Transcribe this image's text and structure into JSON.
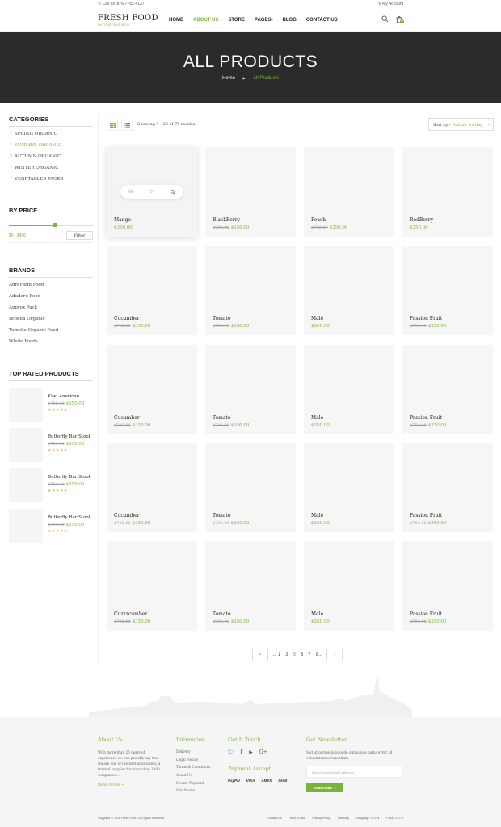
{
  "topbar": {
    "phone": "Call us: 876-7782-4137",
    "account": "My Account"
  },
  "logo": {
    "name": "FRESH FOOD",
    "tagline": "NATURE INSPIRED"
  },
  "nav": [
    "HOME",
    "ABOUT US",
    "STORE",
    "PAGES",
    "BLOG",
    "CONTACT US"
  ],
  "cart_count": "0",
  "banner": {
    "title": "ALL PRODUCTS",
    "crumb_home": "Home",
    "crumb_current": "All Products"
  },
  "sidebar": {
    "categories_title": "CATEGORIES",
    "categories": [
      "SPRING ORGANIC",
      "SUMMER ORGANIC",
      "AUTUMN ORGANIC",
      "WINTER ORGANIC",
      "VEGETABLES PACKS"
    ],
    "price_title": "BY PRICE",
    "price_range": "$0 - $400",
    "filter_label": "Filter",
    "price_slider_fraction": 0.5,
    "brands_title": "BRANDS",
    "brands": [
      "AdreFarm Food",
      "Adudero Food",
      "Approx Pack",
      "Brokita Organic",
      "Tomoko Organic Food",
      "Whole Foods"
    ],
    "top_rated_title": "TOP RATED PRODUCTS",
    "top_rated": [
      {
        "name": "Kiwi Anerican",
        "old": "$700.00",
        "price": "$350.00"
      },
      {
        "name": "Butterfly Bar Stool",
        "old": "$700.00",
        "price": "$350.00"
      },
      {
        "name": "Butterfly Bar Stool",
        "old": "$700.00",
        "price": "$350.00"
      },
      {
        "name": "Butterfly Bar Stool",
        "old": "$700.00",
        "price": "$350.00"
      }
    ]
  },
  "toolbar": {
    "showing": "Showing 1 - 20 of 75 results",
    "sort_label": "Sort by :",
    "sort_value": "Default sorting"
  },
  "products": [
    {
      "name": "Mango",
      "old": "",
      "price": "$350.00"
    },
    {
      "name": "BlackBerry",
      "old": "$700.00",
      "price": "$350.00"
    },
    {
      "name": "Peach",
      "old": "$700.00",
      "price": "$350.00"
    },
    {
      "name": "RedBerry",
      "old": "",
      "price": "$350.00"
    },
    {
      "name": "Cucumber",
      "old": "$700.00",
      "price": "$350.00"
    },
    {
      "name": "Tomato",
      "old": "$700.00",
      "price": "$350.00"
    },
    {
      "name": "Male",
      "old": "",
      "price": "$350.00"
    },
    {
      "name": "Passion Fruit",
      "old": "$700.00",
      "price": "$350.00"
    },
    {
      "name": "Cucumber",
      "old": "$700.00",
      "price": "$350.00"
    },
    {
      "name": "Tomato",
      "old": "$700.00",
      "price": "$350.00"
    },
    {
      "name": "Male",
      "old": "",
      "price": "$350.00"
    },
    {
      "name": "Passion Fruit",
      "old": "$700.00",
      "price": "$350.00"
    },
    {
      "name": "Cucumber",
      "old": "$700.00",
      "price": "$350.00"
    },
    {
      "name": "Tomato",
      "old": "$700.00",
      "price": "$350.00"
    },
    {
      "name": "Male",
      "old": "",
      "price": "$350.00"
    },
    {
      "name": "Passion Fruit",
      "old": "$700.00",
      "price": "$350.00"
    },
    {
      "name": "Cuzzzcumber",
      "old": "$700.00",
      "price": "$350.00"
    },
    {
      "name": "Tomato",
      "old": "$700.00",
      "price": "$350.00"
    },
    {
      "name": "Male",
      "old": "",
      "price": "$350.00"
    },
    {
      "name": "Passion Fruit",
      "old": "$700.00",
      "price": "$350.00"
    }
  ],
  "pagination": {
    "prev": "‹",
    "next": "›",
    "lead": "...",
    "pages": [
      "1",
      "3",
      "5",
      "6",
      "7",
      "8..."
    ],
    "active": "5"
  },
  "footer": {
    "about_title": "About Us",
    "about_text": "With more than 25 years of experience we can proudly say that we are one of the best in business, a trusted supplier for more than 1000 companies...",
    "readmore": "READ MORE",
    "info_title": "Infomation",
    "info_links": [
      "Delivery",
      "Legal Notice",
      "Terms & Conditions",
      "About Us",
      "Secure Payment",
      "Our Stores"
    ],
    "touch_title": "Get It Touch",
    "payment_title": "Payment Accept",
    "payments": [
      "PayPal",
      "VISA",
      "AMEX",
      "Skrill"
    ],
    "newsletter_title": "Get Newsletter",
    "newsletter_text": "Sed ut perspiciatis unde omnis iste natus error sit voluptatem accusantium",
    "email_placeholder": "Enter Your Email Address",
    "subscribe": "SUBSCRIBE",
    "copyright": "Copyright © 2016 Fresh Food - All Rights Reserved.",
    "bottom_links": [
      "Contact Us",
      "Term of Use",
      "Privacy Policy",
      "Site Map"
    ],
    "language_label": "Language:",
    "language_value": "ENG",
    "price_label": "Price:",
    "price_value": "USD"
  },
  "colors": {
    "accent": "#7bb33a",
    "banner": "#2b2b2b",
    "card": "#f6f6f6",
    "star": "#f0b41d"
  }
}
